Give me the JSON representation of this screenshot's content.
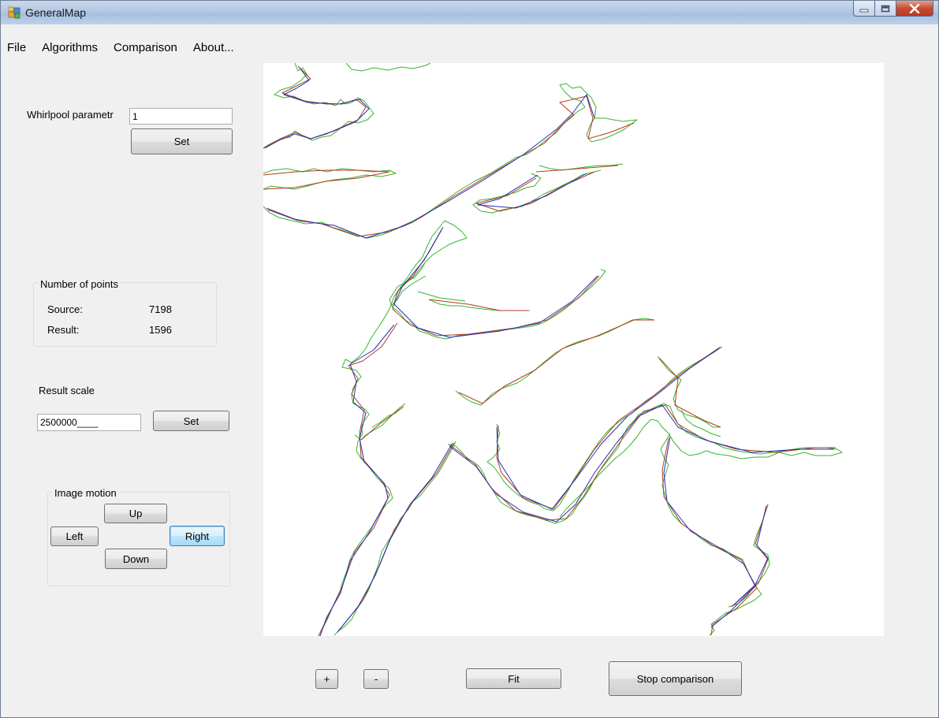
{
  "window": {
    "title": "GeneralMap"
  },
  "menu": [
    "File",
    "Algorithms",
    "Comparison",
    "About..."
  ],
  "whirlpool": {
    "label": "Whirlpool parametr",
    "value": "1",
    "set_label": "Set"
  },
  "points": {
    "group_title": "Number of points",
    "source_label": "Source:",
    "source_value": "7198",
    "result_label": "Result:",
    "result_value": "1596"
  },
  "scale": {
    "label": "Result scale",
    "value": "2500000____",
    "set_label": "Set"
  },
  "motion": {
    "group_title": "Image motion",
    "up": "Up",
    "left": "Left",
    "right": "Right",
    "down": "Down"
  },
  "bottom": {
    "zoom_in": "+",
    "zoom_out": "-",
    "fit": "Fit",
    "stop": "Stop comparison"
  },
  "colors": {
    "source_line": "#36b52c",
    "result_line": "#b23b1e",
    "other_line": "#2630b8",
    "window_bg": "#f0f0f0"
  },
  "icons": [
    "app-icon",
    "minimize-icon",
    "maximize-icon",
    "close-icon"
  ]
}
